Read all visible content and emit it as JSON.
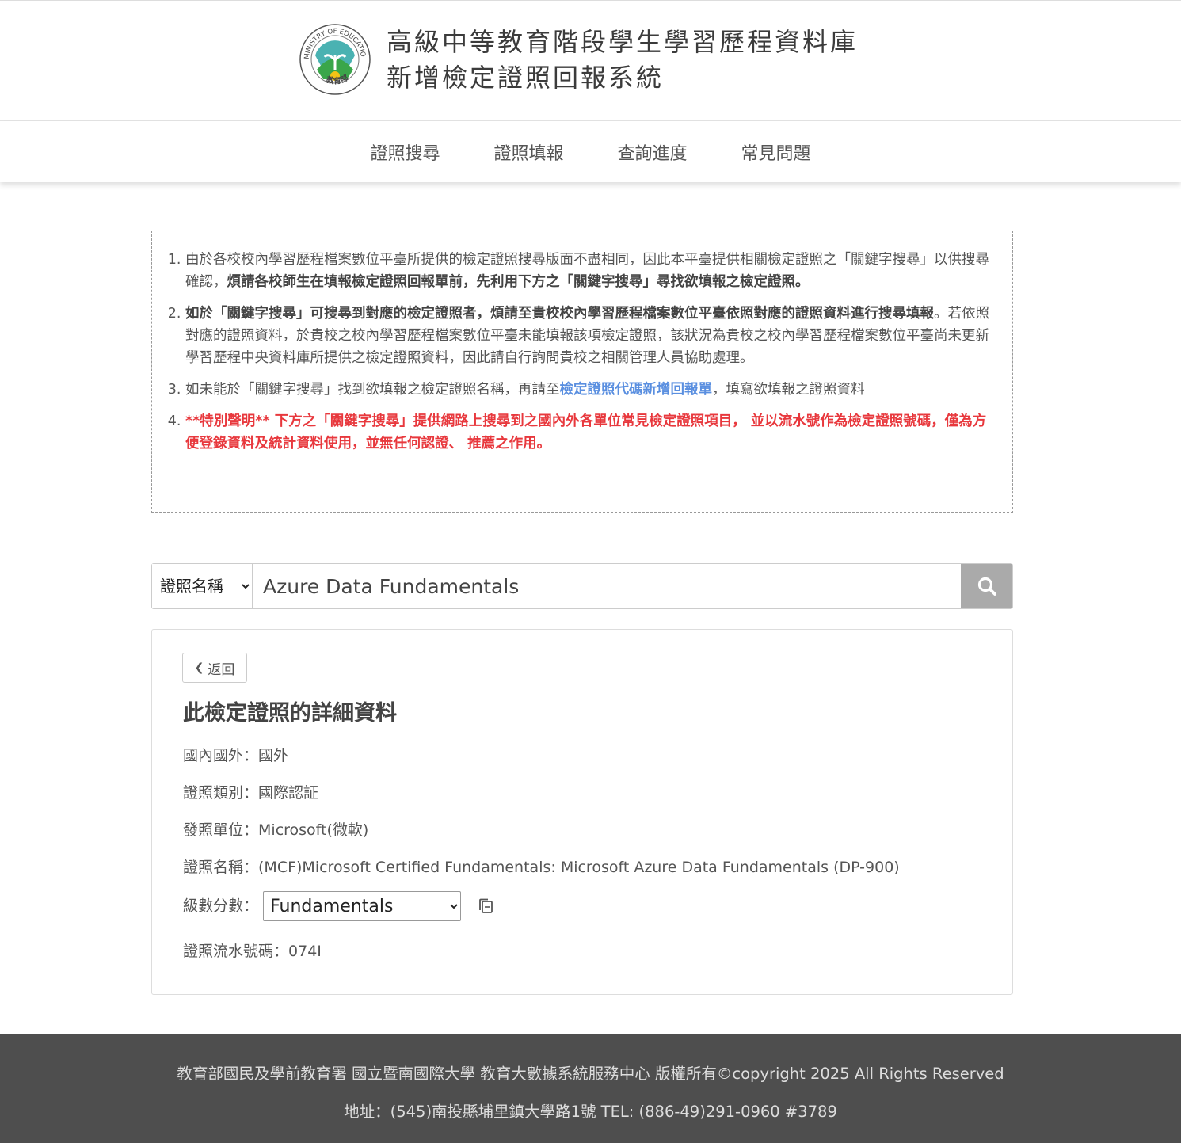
{
  "header": {
    "title_line1": "高級中等教育階段學生學習歷程資料庫",
    "title_line2": "新增檢定證照回報系統",
    "logo_text_top": "MINISTRY OF EDUCATION",
    "logo_text_bottom": "教育部"
  },
  "nav": {
    "items": [
      {
        "label": "證照搜尋"
      },
      {
        "label": "證照填報"
      },
      {
        "label": "查詢進度"
      },
      {
        "label": "常見問題"
      }
    ]
  },
  "notice": {
    "item1_plain": "由於各校校內學習歷程檔案數位平臺所提供的檢定證照搜尋版面不盡相同，因此本平臺提供相關檢定證照之「關鍵字搜尋」以供搜尋確認，",
    "item1_bold": "煩請各校師生在填報檢定證照回報單前，先利用下方之「關鍵字搜尋」尋找欲填報之檢定證照。",
    "item2_bold": "如於「關鍵字搜尋」可搜尋到對應的檢定證照者，煩請至貴校校內學習歷程檔案數位平臺依照對應的證照資料進行搜尋填報",
    "item2_plain": "。若依照對應的證照資料，於貴校之校內學習歷程檔案數位平臺未能填報該項檢定證照，該狀況為貴校之校內學習歷程檔案數位平臺尚未更新學習歷程中央資料庫所提供之檢定證照資料，因此請自行詢問貴校之相關管理人員協助處理。",
    "item3_before": "如未能於「關鍵字搜尋」找到欲填報之檢定證照名稱，再請至",
    "item3_link": "檢定證照代碼新增回報單",
    "item3_after": "，填寫欲填報之證照資料",
    "item4_red": "**特別聲明** 下方之「關鍵字搜尋」提供網路上搜尋到之國內外各單位常見檢定證照項目， 並以流水號作為檢定證照號碼，僅為方便登錄資料及統計資料使用，並無任何認證、 推薦之作用。"
  },
  "search": {
    "field_selected": "證照名稱",
    "query": "Azure Data Fundamentals",
    "icon": "search-icon"
  },
  "detail": {
    "back_label": "返回",
    "heading": "此檢定證照的詳細資料",
    "domestic_label": "國內國外：",
    "domestic_value": "國外",
    "category_label": "證照類別：",
    "category_value": "國際認証",
    "issuer_label": "發照單位：",
    "issuer_value": "Microsoft(微軟)",
    "name_label": "證照名稱：",
    "name_value": "(MCF)Microsoft Certified Fundamentals: Microsoft Azure Data Fundamentals (DP-900)",
    "level_label": "級數分數：",
    "level_selected": "Fundamentals",
    "serial_label": "證照流水號碼：",
    "serial_value": "074I"
  },
  "footer": {
    "line1": "教育部國民及學前教育署 國立暨南國際大學 教育大數據系統服務中心 版權所有©copyright 2025 All Rights Reserved",
    "line2": "地址：(545)南投縣埔里鎮大學路1號 TEL: (886-49)291-0960 #3789"
  },
  "colors": {
    "link": "#5a8fe0",
    "warning": "#e8383d",
    "footer_bg": "#4e4e4e",
    "search_button": "#aaaaaa",
    "logo_green": "#3aa64a",
    "logo_teal": "#2aa5a5"
  }
}
